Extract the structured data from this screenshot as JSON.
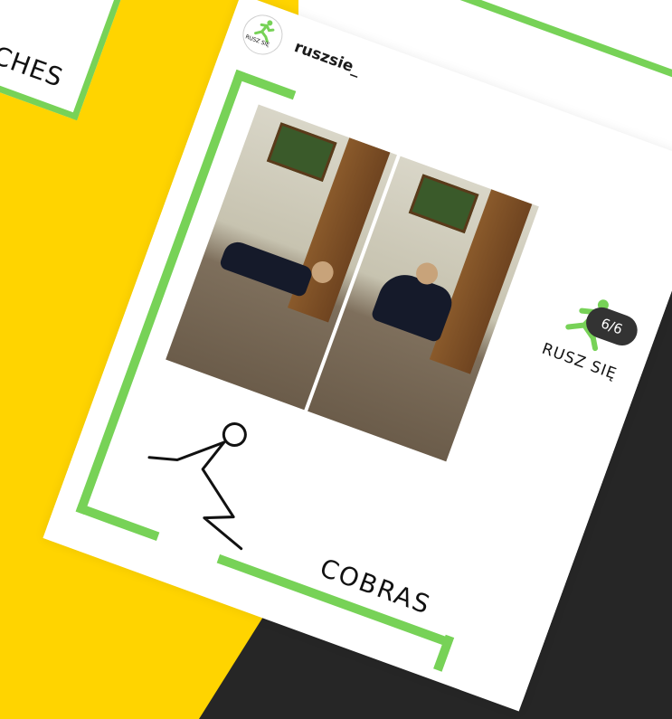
{
  "previous_card": {
    "caption": "CHES"
  },
  "post": {
    "avatar_label": "RUSZ SIĘ",
    "username": "ruszsie_",
    "more_icon": "more-vertical-icon",
    "slide": {
      "counter": "6/6",
      "brand_text": "RUSZ SIĘ",
      "exercise_name": "COBRAS"
    }
  },
  "colors": {
    "accent_green": "#77d257",
    "yellow": "#ffd400",
    "dark": "#262626"
  }
}
